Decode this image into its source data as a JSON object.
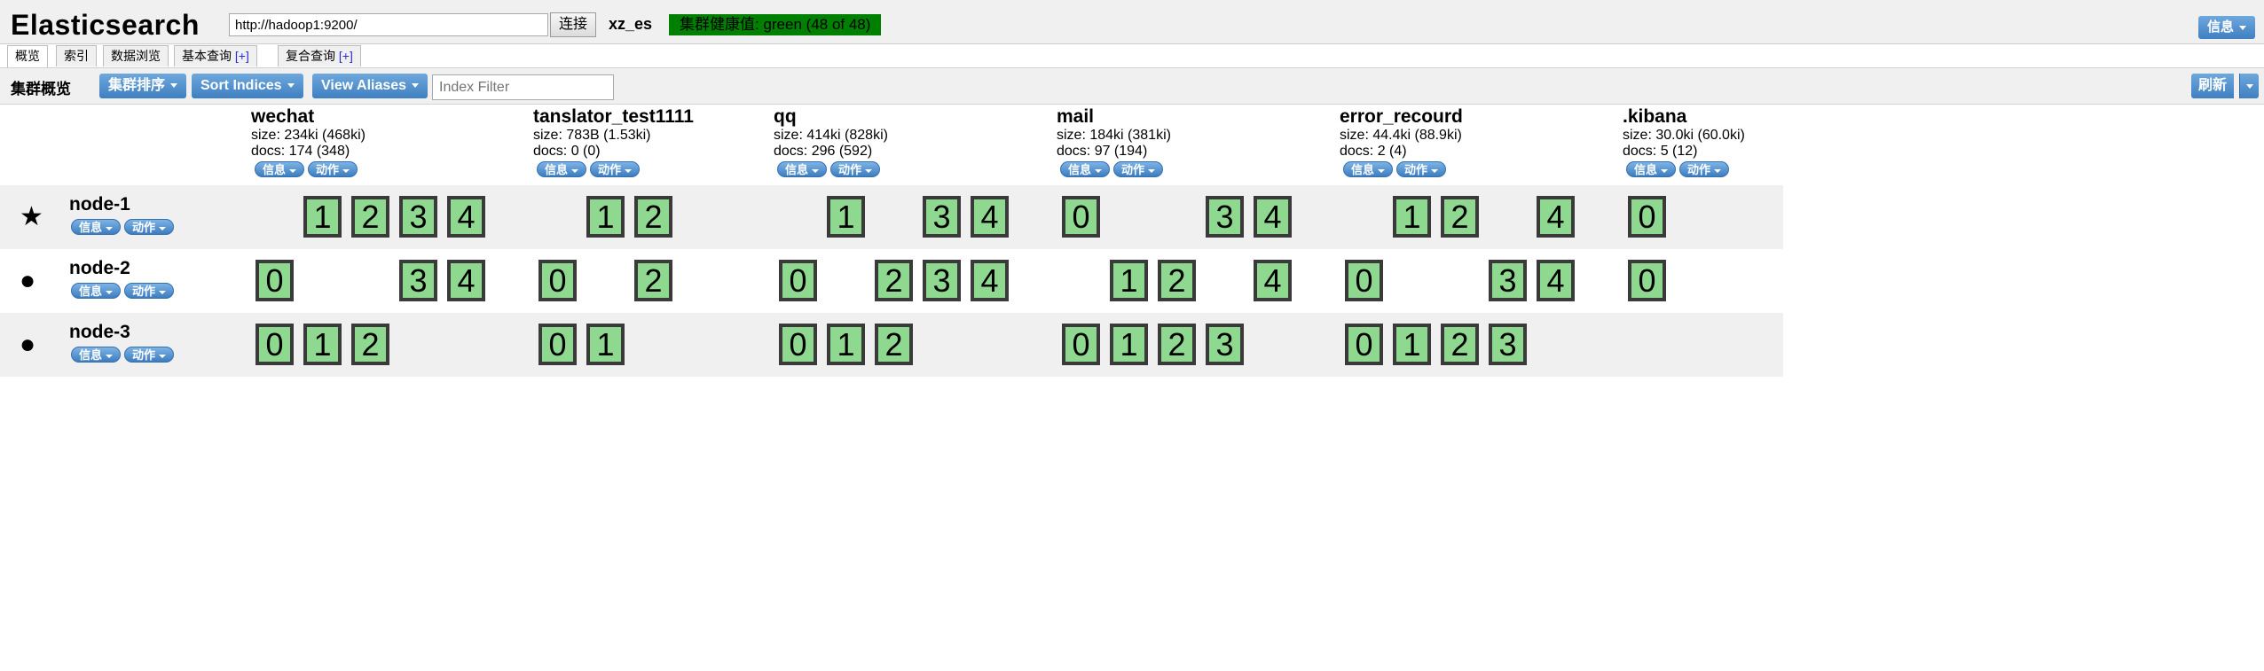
{
  "header": {
    "app_title": "Elasticsearch",
    "url_value": "http://hadoop1:9200/",
    "connect_label": "连接",
    "cluster_name": "xz_es",
    "health_text": "集群健康值: green (48 of 48)",
    "info_label": "信息",
    "colors": {
      "health_green": "#008000",
      "button_blue": "#3f7fc1",
      "shard_green": "#8fd88f"
    }
  },
  "tabs": [
    {
      "label": "概览",
      "active": true
    },
    {
      "label": "索引"
    },
    {
      "label": "数据浏览"
    },
    {
      "label": "基本查询",
      "plus": "[+]"
    },
    {
      "label": "复合查询",
      "plus": "[+]"
    }
  ],
  "toolbar": {
    "title": "集群概览",
    "sort_cluster_label": "集群排序",
    "sort_indices_label": "Sort Indices",
    "view_aliases_label": "View Aliases",
    "index_filter_placeholder": "Index Filter",
    "refresh_label": "刷新"
  },
  "pill_labels": {
    "info": "信息",
    "action": "动作"
  },
  "indices": [
    {
      "name": "wechat",
      "size": "size: 234ki (468ki)",
      "docs": "docs: 174 (348)"
    },
    {
      "name": "tanslator_test1111",
      "size": "size: 783B (1.53ki)",
      "docs": "docs: 0 (0)"
    },
    {
      "name": "qq",
      "size": "size: 414ki (828ki)",
      "docs": "docs: 296 (592)"
    },
    {
      "name": "mail",
      "size": "size: 184ki (381ki)",
      "docs": "docs: 97 (194)"
    },
    {
      "name": "error_recourd",
      "size": "size: 44.4ki (88.9ki)",
      "docs": "docs: 2 (4)"
    },
    {
      "name": ".kibana",
      "size": "size: 30.0ki (60.0ki)",
      "docs": "docs: 5 (12)"
    }
  ],
  "nodes": [
    {
      "name": "node-1",
      "icon": "star-icon",
      "glyph": "★",
      "shards": [
        [
          "1",
          "2",
          "3",
          "4"
        ],
        [
          "1",
          "2"
        ],
        [
          "1",
          "3",
          "4"
        ],
        [
          "0",
          "3",
          "4"
        ],
        [
          "1",
          "2",
          "4"
        ],
        [
          "0"
        ]
      ]
    },
    {
      "name": "node-2",
      "icon": "circle-icon",
      "glyph": "●",
      "shards": [
        [
          "0",
          "3",
          "4"
        ],
        [
          "0",
          "2"
        ],
        [
          "0",
          "2",
          "3",
          "4"
        ],
        [
          "1",
          "2",
          "4"
        ],
        [
          "0",
          "3",
          "4"
        ],
        [
          "0"
        ]
      ]
    },
    {
      "name": "node-3",
      "icon": "circle-icon",
      "glyph": "●",
      "shards": [
        [
          "0",
          "1",
          "2"
        ],
        [
          "0",
          "1"
        ],
        [
          "0",
          "1",
          "2"
        ],
        [
          "0",
          "1",
          "2",
          "3"
        ],
        [
          "0",
          "1",
          "2",
          "3"
        ],
        []
      ]
    }
  ]
}
